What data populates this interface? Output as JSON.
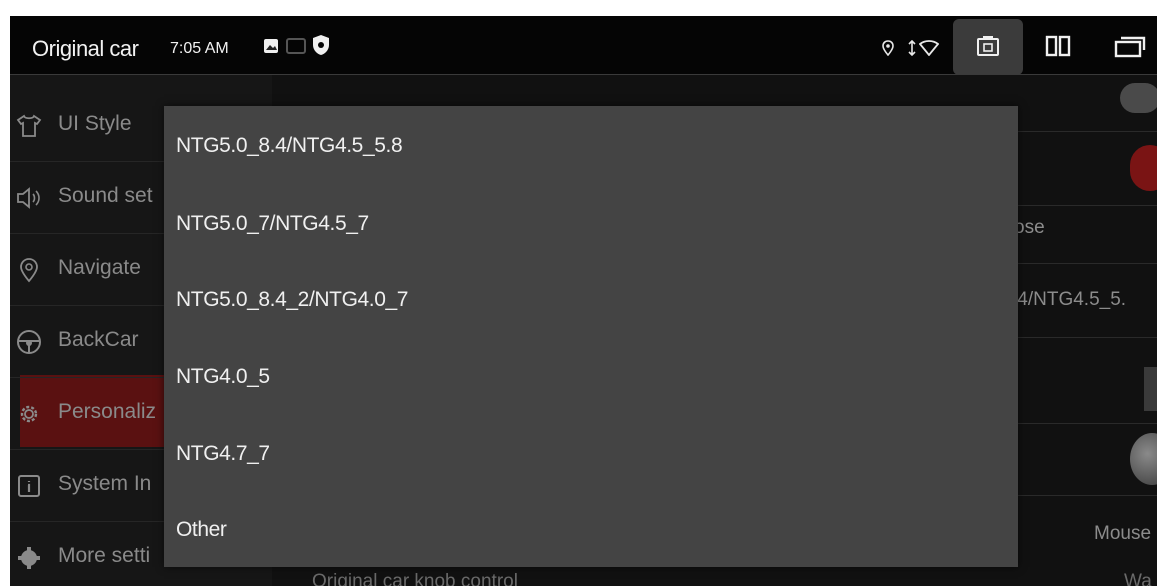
{
  "status_bar": {
    "app_title": "Original car",
    "time": "7:05 AM",
    "icons": [
      "image-icon",
      "cast-icon",
      "shield-icon",
      "location-icon",
      "data-transfer-icon",
      "wifi-icon",
      "screenshot-icon",
      "split-screen-icon",
      "recent-windows-icon"
    ]
  },
  "sidebar": {
    "items": [
      {
        "label": "UI Style",
        "icon": "shirt-icon"
      },
      {
        "label": "Sound set",
        "icon": "speaker-icon"
      },
      {
        "label": "Navigate",
        "icon": "location-pin-icon"
      },
      {
        "label": "BackCar",
        "icon": "steering-wheel-icon"
      },
      {
        "label": "Personaliz",
        "icon": "gear-icon"
      },
      {
        "label": "System In",
        "icon": "info-icon"
      },
      {
        "label": "More setti",
        "icon": "more-settings-icon"
      }
    ]
  },
  "content": {
    "partial_right_texts": [
      "ose",
      ".4/NTG4.5_5.",
      "Mouse",
      "Wa"
    ],
    "bottom_label": "Original car knob control"
  },
  "dropdown": {
    "options": [
      "NTG5.0_8.4/NTG4.5_5.8",
      "NTG5.0_7/NTG4.5_7",
      "NTG5.0_8.4_2/NTG4.0_7",
      "NTG4.0_5",
      "NTG4.7_7",
      "Other"
    ]
  },
  "colors": {
    "accent_red": "#7a1414",
    "dropdown_bg": "#444444",
    "screen_bg": "#131313"
  }
}
